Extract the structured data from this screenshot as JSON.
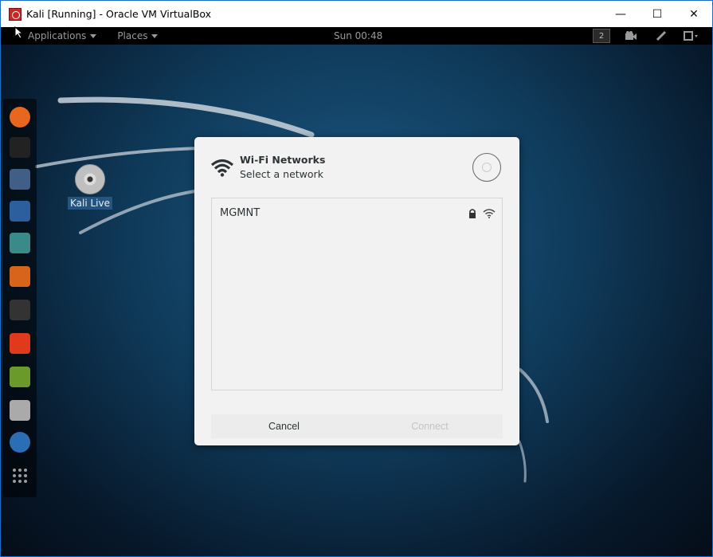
{
  "window": {
    "title": "Kali [Running] - Oracle VM VirtualBox",
    "minimize_glyph": "—",
    "maximize_glyph": "☐",
    "close_glyph": "✕"
  },
  "topbar": {
    "applications_label": "Applications",
    "places_label": "Places",
    "clock": "Sun 00:48",
    "workspace_number": "2",
    "icons": [
      "camera-icon",
      "pen-icon",
      "power-menu-icon"
    ]
  },
  "dock": {
    "items": [
      "firefox-icon",
      "terminal-icon",
      "files-icon",
      "metasploit-icon",
      "armitage-icon",
      "burpsuite-icon",
      "maltego-icon",
      "faraday-icon",
      "leafpad-icon",
      "cherrytree-icon",
      "downloader-icon",
      "show-apps-icon"
    ],
    "colors": [
      "#e8661e",
      "#222222",
      "#3f5f86",
      "#2b5f9e",
      "#3a8a8a",
      "#d8641c",
      "#333333",
      "#e0391c",
      "#6a9a2a",
      "#aaaaaa",
      "#2a6fb5",
      "#333333"
    ]
  },
  "desktop": {
    "icon_label": "Kali Live"
  },
  "dialog": {
    "title": "Wi-Fi Networks",
    "subtitle": "Select a network",
    "networks": [
      {
        "name": "MGMNT",
        "secured": true
      }
    ],
    "cancel_label": "Cancel",
    "connect_label": "Connect"
  }
}
